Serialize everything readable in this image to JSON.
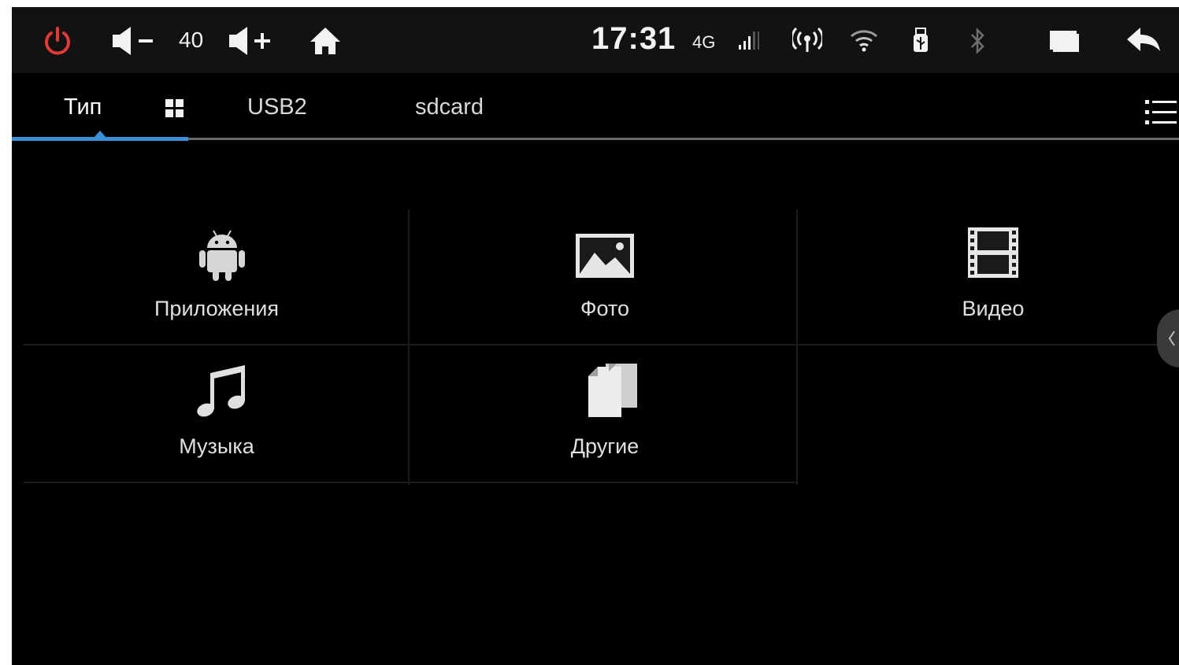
{
  "status_bar": {
    "volume": "40",
    "time": "17:31",
    "network": "4G",
    "power_color": "#e53935",
    "icons": [
      "power-icon",
      "volume-down-icon",
      "volume-up-icon",
      "home-icon",
      "signal-icon",
      "hotspot-icon",
      "wifi-icon",
      "usb-icon",
      "bluetooth-icon",
      "window-icon",
      "back-icon"
    ]
  },
  "tabs": {
    "type_label": "Тип",
    "usb_label": "USB2",
    "sdcard_label": "sdcard",
    "active": "Тип",
    "accent": "#3a8fd8"
  },
  "categories": {
    "apps": "Приложения",
    "photo": "Фото",
    "video": "Видео",
    "music": "Музыка",
    "other": "Другие"
  }
}
